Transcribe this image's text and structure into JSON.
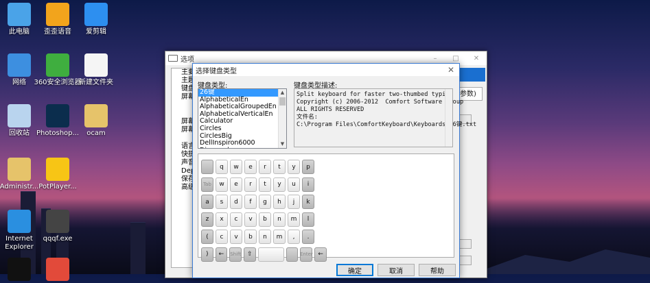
{
  "desktop": {
    "icons": [
      {
        "label": "此电脑",
        "icon": "computer-icon",
        "color": "#4aa3e8"
      },
      {
        "label": "歪歪语音",
        "icon": "yy-icon",
        "color": "#f2a41c"
      },
      {
        "label": "爱剪辑",
        "icon": "aijianji-icon",
        "color": "#2d8ff0"
      },
      {
        "label": "网络",
        "icon": "network-icon",
        "color": "#3d8fe0"
      },
      {
        "label": "360安全浏览器",
        "icon": "browser-360-icon",
        "color": "#3fae3f"
      },
      {
        "label": "新建文件夹",
        "icon": "file-icon",
        "color": "#f5f5f5"
      },
      {
        "label": "回收站",
        "icon": "recycle-bin-icon",
        "color": "#b9d4ee"
      },
      {
        "label": "Photoshop...",
        "icon": "photoshop-icon",
        "color": "#0b2d4d"
      },
      {
        "label": "ocam",
        "icon": "folder-icon",
        "color": "#e6c36a"
      },
      {
        "label": "Administr...",
        "icon": "user-folder-icon",
        "color": "#e6c36a"
      },
      {
        "label": "PotPlayer...",
        "icon": "potplayer-icon",
        "color": "#f7c515"
      },
      {
        "label": "Internet Explorer",
        "icon": "ie-icon",
        "color": "#2a8fe0"
      },
      {
        "label": "qqqf.exe",
        "icon": "exe-icon",
        "color": "#444"
      },
      {
        "label": "",
        "icon": "qq-icon",
        "color": "#111"
      },
      {
        "label": "",
        "icon": "app-icon",
        "color": "#e24a3a"
      }
    ]
  },
  "options_window": {
    "title": "选项",
    "tree": [
      "主要",
      "主题",
      "键盘",
      "屏幕",
      "",
      "",
      "屏幕",
      "屏幕",
      "",
      "语言",
      "快捷",
      "声音",
      "Depe",
      "保存",
      "高级"
    ],
    "partial_text": "参数)"
  },
  "dialog": {
    "title": "选择键盘类型",
    "list_label": "键盘类型:",
    "desc_label": "键盘类型描述:",
    "keyboard_types": [
      "26键",
      "AlphabeticalEn",
      "AlphabeticalGroupedEn",
      "AlphabeticalVerticalEn",
      "Calculator",
      "Circles",
      "CirclesBig",
      "DellInspiron6000",
      "Diamonds"
    ],
    "selected_index": 0,
    "description_lines": [
      "Split keyboard for faster two-thumbed typing",
      "",
      "Copyright (c) 2006-2012  Comfort Software Group",
      "ALL RIGHTS RESERVED",
      "",
      "文件名:",
      "C:\\Program Files\\ComfortKeyboard\\Keyboards\\26键.txt"
    ],
    "keyboard_rows": [
      [
        "",
        "q",
        "w",
        "e",
        "r",
        "t",
        "y",
        "p"
      ],
      [
        "Tab",
        "w",
        "e",
        "r",
        "t",
        "y",
        "u",
        "i"
      ],
      [
        "a",
        "s",
        "d",
        "f",
        "g",
        "h",
        "j",
        "k"
      ],
      [
        "z",
        "x",
        "c",
        "v",
        "b",
        "n",
        "m",
        "l"
      ],
      [
        "(",
        "c",
        "v",
        "b",
        "n",
        "m",
        ",",
        "."
      ],
      [
        ")",
        "←",
        "Shift",
        "⇧",
        "Space",
        "",
        "Enter",
        "←"
      ]
    ],
    "buttons": {
      "ok": "确定",
      "cancel": "取消",
      "help": "帮助"
    }
  }
}
